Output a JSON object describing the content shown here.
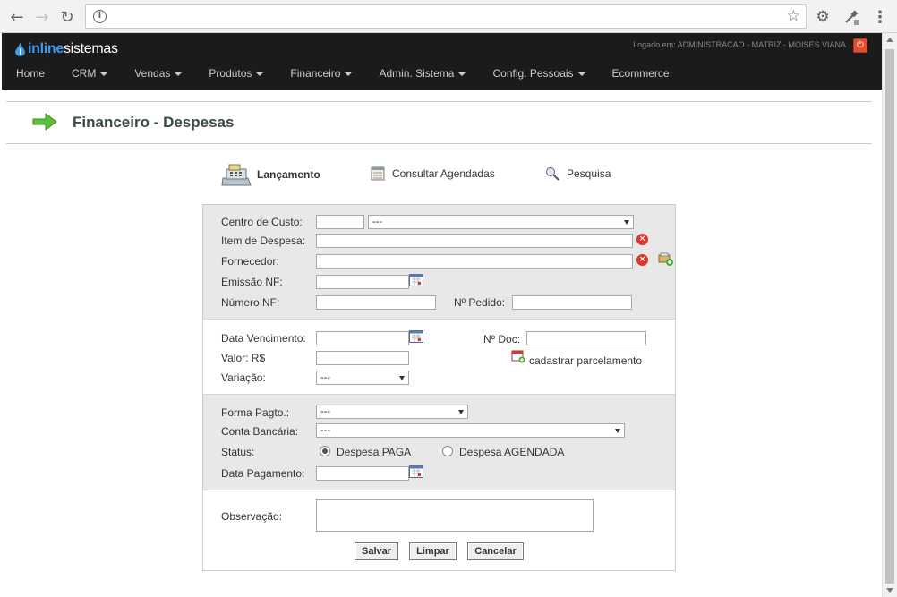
{
  "browser": {
    "url": ""
  },
  "app": {
    "logo_part1": "inline",
    "logo_part2": "sistemas",
    "logged_text": "Logado em: ADMINISTRACAO - MATRIZ - MOISES VIANA",
    "menu": [
      {
        "label": "Home",
        "dropdown": false
      },
      {
        "label": "CRM",
        "dropdown": true
      },
      {
        "label": "Vendas",
        "dropdown": true
      },
      {
        "label": "Produtos",
        "dropdown": true
      },
      {
        "label": "Financeiro",
        "dropdown": true
      },
      {
        "label": "Admin. Sistema",
        "dropdown": true
      },
      {
        "label": "Config. Pessoais",
        "dropdown": true
      },
      {
        "label": "Ecommerce",
        "dropdown": false
      }
    ]
  },
  "page": {
    "title": "Financeiro - Despesas",
    "tabs": {
      "lancamento": "Lançamento",
      "consultar": "Consultar Agendadas",
      "pesquisa": "Pesquisa"
    }
  },
  "form": {
    "centro_custo": {
      "label": "Centro de Custo:",
      "code": "",
      "selected": "---"
    },
    "item_despesa": {
      "label": "Item de Despesa:",
      "value": ""
    },
    "fornecedor": {
      "label": "Fornecedor:",
      "value": ""
    },
    "emissao_nf": {
      "label": "Emissão NF:",
      "value": ""
    },
    "numero_nf": {
      "label": "Número NF:",
      "value": ""
    },
    "numero_pedido": {
      "label": "Nº Pedido:",
      "value": ""
    },
    "data_vencimento": {
      "label": "Data Vencimento:",
      "value": ""
    },
    "numero_doc": {
      "label": "Nº Doc:",
      "value": ""
    },
    "valor": {
      "label": "Valor: R$",
      "value": ""
    },
    "cadastrar_parcelamento": "cadastrar parcelamento",
    "variacao": {
      "label": "Variação:",
      "selected": "---"
    },
    "forma_pagto": {
      "label": "Forma Pagto.:",
      "selected": "---"
    },
    "conta_bancaria": {
      "label": "Conta Bancária:",
      "selected": "---"
    },
    "status": {
      "label": "Status:",
      "option_paga": "Despesa PAGA",
      "option_agendada": "Despesa AGENDADA",
      "selected": "paga"
    },
    "data_pagamento": {
      "label": "Data Pagamento:",
      "value": ""
    },
    "observacao": {
      "label": "Observação:",
      "value": ""
    },
    "buttons": {
      "salvar": "Salvar",
      "limpar": "Limpar",
      "cancelar": "Cancelar"
    }
  }
}
